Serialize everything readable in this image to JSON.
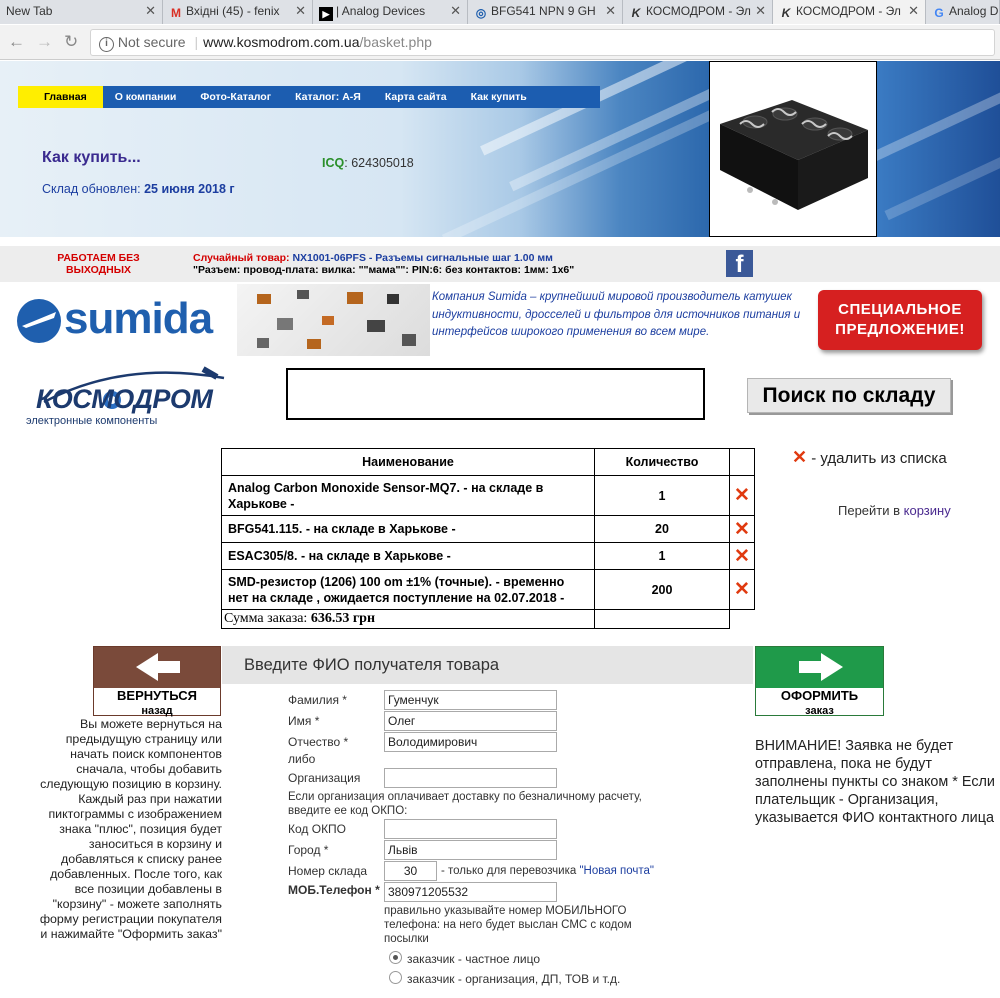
{
  "browser": {
    "tabs": [
      {
        "label": "New Tab",
        "icon": "blank-icon"
      },
      {
        "label": "Вхідні (45) - fenix",
        "icon": "gmail-icon"
      },
      {
        "label": "| Analog Devices",
        "icon": "analog-devices-icon"
      },
      {
        "label": "BFG541 NPN 9 GH",
        "icon": "site-icon"
      },
      {
        "label": "КОСМОДРОМ - Эл",
        "icon": "kosmodrom-icon"
      },
      {
        "label": "КОСМОДРОМ - Эл",
        "icon": "kosmodrom-icon"
      },
      {
        "label": "Analog D",
        "icon": "google-icon"
      }
    ],
    "active_tab": 5,
    "security": "Not secure",
    "url_host": "www.kosmodrom.com.ua",
    "url_path": "/basket.php"
  },
  "header": {
    "nav": [
      "Главная",
      "О компании",
      "Фото-Каталог",
      "Каталог: А-Я",
      "Карта сайта",
      "Как купить"
    ],
    "page_heading": "Как купить...",
    "stock_updated_label": "Склад обновлен:",
    "stock_updated_date": "25 июня 2018 г",
    "icq_label": "ICQ",
    "icq_number": "624305018"
  },
  "strip": {
    "no_days_off": "РАБОТАЕМ БЕЗ ВЫХОДНЫХ",
    "random_label": "Случайный товар:",
    "random_product": "NX1001-06PFS - Разъемы сигнальные шаг 1.00 мм",
    "random_desc": "\"Разъем: провод-плата: вилка: \"\"мама\"\": PIN:6: без контактов: 1мм: 1х6\"",
    "go_to": "Перейти в",
    "cart_link": "корзину"
  },
  "sumida": {
    "logo": "sumida",
    "text": "Компания Sumida – крупнейший мировой производитель катушек индуктивности, дросселей и фильтров для источников питания и интерфейсов широкого применения во всем мире.",
    "special_line1": "СПЕЦИАЛЬНОЕ",
    "special_line2": "ПРЕДЛОЖЕНИЕ!"
  },
  "logo": {
    "name": "КОСМОДРОМ",
    "subtitle": "электронные компоненты"
  },
  "search": {
    "button": "Поиск по складу"
  },
  "cart": {
    "col_name": "Наименование",
    "col_qty": "Количество",
    "delete_hint": "- удалить из списка",
    "rows": [
      {
        "name": "Analog Carbon Monoxide Sensor-MQ7. - на складе в Харькове -",
        "qty": "1"
      },
      {
        "name": "BFG541.115. - на складе в Харькове -",
        "qty": "20"
      },
      {
        "name": "ESAC305/8. - на складе в Харькове -",
        "qty": "1"
      },
      {
        "name": "SMD-резистор (1206) 100 om ±1% (точные). - временно нет на складе , ожидается поступление на 02.07.2018 -",
        "qty": "200"
      }
    ],
    "sum_label": "Сумма заказа:",
    "sum_value": "636.53 грн"
  },
  "back": {
    "label": "ВЕРНУТЬСЯ",
    "sub": "назад",
    "help": "Вы можете вернуться на предыдущую страницу или начать поиск компонентов сначала, чтобы добавить следующую позицию в корзину. Каждый раз при нажатии пиктограммы с изображением знака \"плюс\", позиция будет заноситься в корзину и добавляться к списку ранее добавленных. После того, как все позиции добавлены в \"корзину\" - можете заполнять форму регистрации покупателя и нажимайте \"Оформить заказ\""
  },
  "form": {
    "title": "Введите ФИО получателя товара",
    "surname_label": "Фамилия *",
    "surname": "Гуменчук",
    "name_label": "Имя *",
    "name": "Олег",
    "patronymic_label": "Отчество *",
    "patronymic": "Володимирович",
    "or": "либо",
    "org_label": "Организация",
    "org": "",
    "org_note": "Если организация оплачивает доставку по безналичному расчету, введите ее код ОКПО:",
    "okpo_label": "Код ОКПО",
    "okpo": "",
    "city_label": "Город *",
    "city": "Львів",
    "warehouse_label": "Номер склада",
    "warehouse": "30",
    "warehouse_note": "- только для перевозчика",
    "carrier": "\"Новая почта\"",
    "phone_label": "МОБ.Телефон *",
    "phone": "380971205532",
    "phone_note": "правильно указывайте номер МОБИЛЬНОГО телефона: на него будет выслан СМС с кодом посылки",
    "radio_private": "заказчик - частное лицо",
    "radio_org": "заказчик - организация, ДП, ТОВ и т.д."
  },
  "submit": {
    "label": "ОФОРМИТЬ",
    "sub": "заказ",
    "warning": "ВНИМАНИЕ! Заявка не будет отправлена, пока не будут заполнены пункты со знаком * Если плательщик - Организация, указывается ФИО контактного лица"
  },
  "colors": {
    "nav_bg": "#1c5db0",
    "nav_active": "#ffee00",
    "delete_x": "#e03a10",
    "back_brown": "#7a4a3a",
    "submit_green": "#1f9a4a"
  }
}
